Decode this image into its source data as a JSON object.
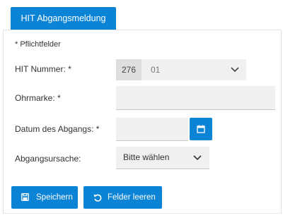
{
  "tab": {
    "label": "HIT Abgangsmeldung"
  },
  "form": {
    "required_note": "* Pflichtfelder",
    "hit_nummer": {
      "label": "HIT Nummer: *",
      "prefix": "276",
      "value": "01"
    },
    "ohrmarke": {
      "label": "Ohrmarke: *",
      "value": ""
    },
    "datum": {
      "label": "Datum des Abgangs: *",
      "value": ""
    },
    "ursache": {
      "label": "Abgangsursache:",
      "selected": "Bitte wählen"
    }
  },
  "buttons": {
    "save_label": "Speichern",
    "clear_label": "Felder leeren"
  },
  "colors": {
    "primary": "#0b84d6",
    "field_bg": "#f0f0f0",
    "prefix_bg": "#dedede"
  },
  "icons": {
    "save": "floppy-disk-icon",
    "clear": "reset-icon",
    "calendar": "calendar-icon",
    "dropdown": "chevron-down-icon"
  }
}
